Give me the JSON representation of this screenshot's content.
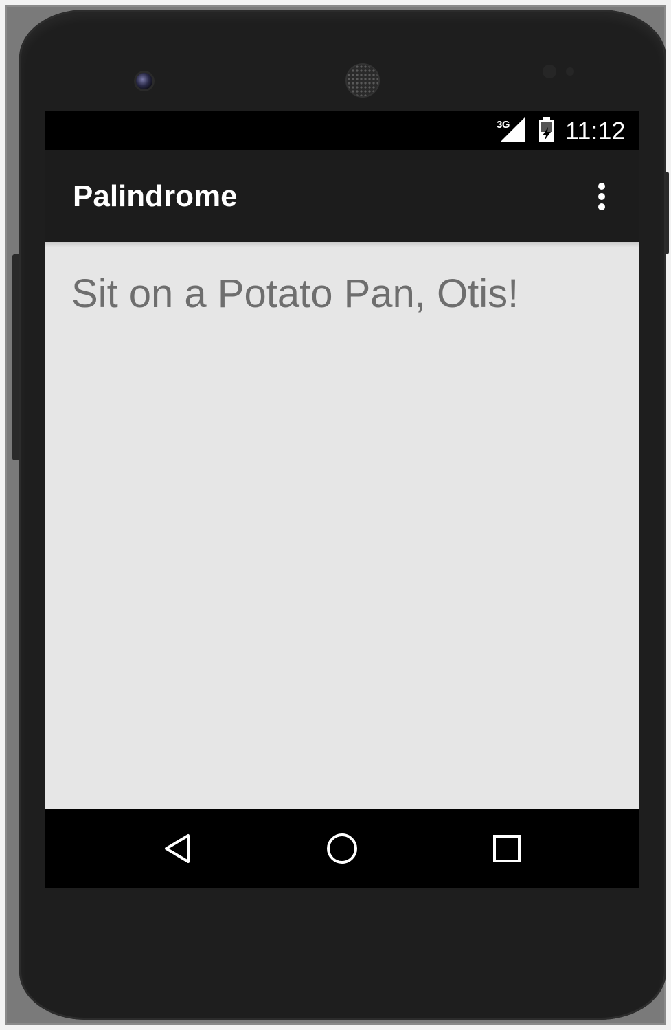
{
  "status_bar": {
    "network": "3G",
    "time": "11:12"
  },
  "app_bar": {
    "title": "Palindrome",
    "overflow_icon": "more-vert-icon"
  },
  "content": {
    "text": "Sit on a Potato Pan, Otis!"
  },
  "nav_bar": {
    "back_icon": "back-triangle-icon",
    "home_icon": "home-circle-icon",
    "recents_icon": "recents-square-icon"
  },
  "colors": {
    "status_bar_bg": "#000000",
    "app_bar_bg": "#1c1c1c",
    "content_bg": "#e6e6e6",
    "content_text": "#6e6e6e",
    "nav_bar_bg": "#000000",
    "device_body": "#1e1e1e"
  }
}
